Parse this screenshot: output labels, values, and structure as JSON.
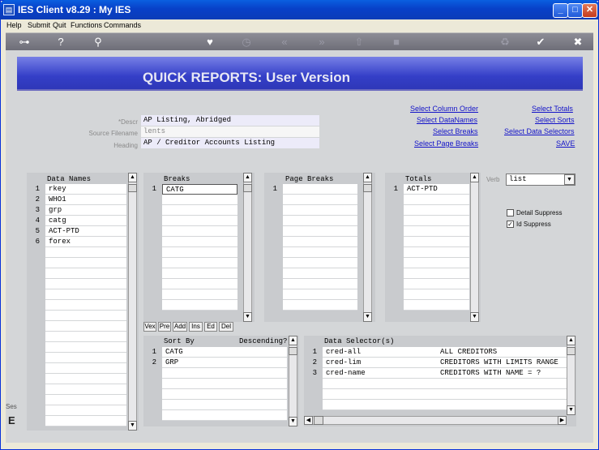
{
  "window": {
    "title": "IES Client v8.29 : My IES"
  },
  "menu": [
    "Help",
    "Submit",
    "Quit",
    "Functions",
    "Commands"
  ],
  "toolbar": {
    "icons": [
      "key-icon",
      "help-icon",
      "search-icon",
      "heart-icon",
      "clock-icon",
      "rewind-icon",
      "fast-forward-icon",
      "upload-icon",
      "stop-icon",
      "recycle-icon",
      "check-icon",
      "close-icon"
    ]
  },
  "banner": {
    "title": "QUICK REPORTS: User Version"
  },
  "form": {
    "descr_label": "*Descr",
    "descr_value": "AP Listing, Abridged",
    "source_label": "Source Filename",
    "source_value": "lents",
    "heading_label": "Heading",
    "heading_value": "AP / Creditor Accounts Listing"
  },
  "links": {
    "col1": [
      "Select Column Order",
      "Select DataNames",
      "Select Breaks",
      "Select Page Breaks"
    ],
    "col2": [
      "Select Totals",
      "Select Sorts",
      "Select Data Selectors",
      "SAVE"
    ]
  },
  "data_names": {
    "header": "Data Names",
    "items": [
      "rkey",
      "WHO1",
      "grp",
      "catg",
      "ACT-PTD",
      "forex"
    ]
  },
  "breaks": {
    "header": "Breaks",
    "items": [
      "CATG"
    ]
  },
  "page_breaks": {
    "header": "Page Breaks",
    "items": [
      ""
    ]
  },
  "totals": {
    "header": "Totals",
    "items": [
      "ACT-PTD"
    ]
  },
  "verb": {
    "label": "Verb",
    "value": "list"
  },
  "options": {
    "detail_suppress": {
      "label": "Detail Suppress",
      "checked": false
    },
    "id_suppress": {
      "label": "Id Suppress",
      "checked": true
    }
  },
  "break_buttons": [
    "Vex",
    "Pre",
    "Add",
    "Ins",
    "Ed",
    "Del"
  ],
  "sort": {
    "header": "Sort By",
    "desc_header": "Descending?",
    "items": [
      "CATG",
      "GRP"
    ]
  },
  "selectors": {
    "header": "Data Selector(s)",
    "items": [
      {
        "code": "cred-all",
        "desc": "ALL CREDITORS"
      },
      {
        "code": "cred-lim",
        "desc": "CREDITORS WITH LIMITS RANGE"
      },
      {
        "code": "cred-name",
        "desc": "CREDITORS WITH NAME = ?"
      }
    ]
  },
  "side": {
    "label": "Ses",
    "letter": "E"
  }
}
